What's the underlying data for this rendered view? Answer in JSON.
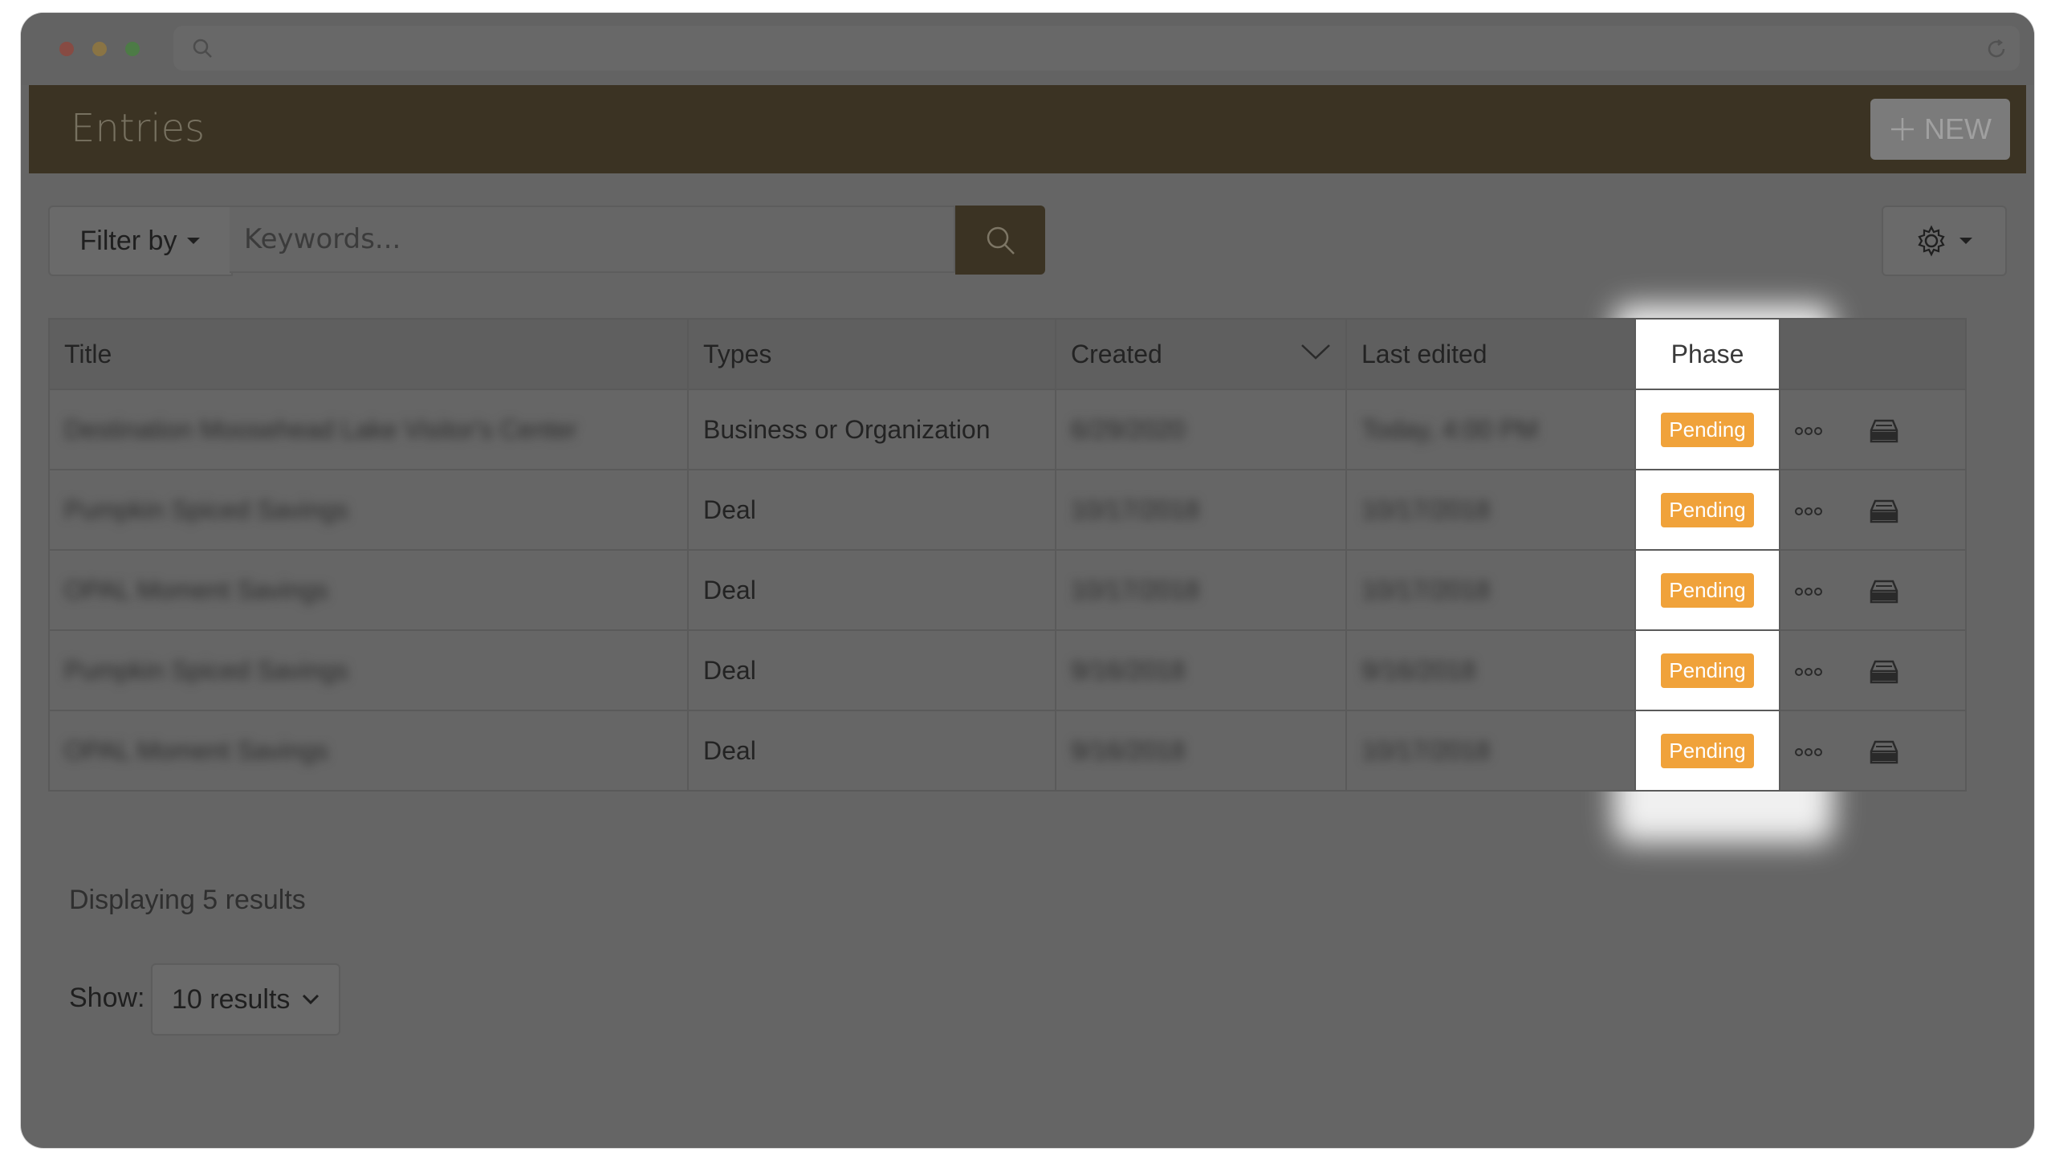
{
  "page": {
    "title": "Entries"
  },
  "header": {
    "new_label": "NEW"
  },
  "search": {
    "filter_label": "Filter by",
    "placeholder": "Keywords..."
  },
  "table": {
    "headers": {
      "title": "Title",
      "types": "Types",
      "created": "Created",
      "last_edited": "Last edited",
      "phase": "Phase"
    },
    "rows": [
      {
        "title": "Destination Moosehead Lake Visitor's Center",
        "type": "Business or Organization",
        "created": "6/29/2020",
        "edited": "Today, 4:00 PM",
        "phase": "Pending"
      },
      {
        "title": "Pumpkin Spiced Savings",
        "type": "Deal",
        "created": "10/17/2018",
        "edited": "10/17/2018",
        "phase": "Pending"
      },
      {
        "title": "OPAL Moment Savings",
        "type": "Deal",
        "created": "10/17/2018",
        "edited": "10/17/2018",
        "phase": "Pending"
      },
      {
        "title": "Pumpkin Spiced Savings",
        "type": "Deal",
        "created": "9/16/2018",
        "edited": "9/16/2018",
        "phase": "Pending"
      },
      {
        "title": "OPAL Moment Savings",
        "type": "Deal",
        "created": "9/16/2018",
        "edited": "10/17/2018",
        "phase": "Pending"
      }
    ]
  },
  "footer": {
    "results_text": "Displaying 5 results",
    "show_label": "Show:",
    "show_value": "10 results"
  },
  "colors": {
    "header_bg": "#3b3323",
    "badge": "#f0a23a",
    "overlay": "#656565"
  },
  "icons": {
    "search": "search-icon",
    "settings": "gear-icon",
    "more": "ellipsis-icon",
    "archive": "archive-icon"
  }
}
